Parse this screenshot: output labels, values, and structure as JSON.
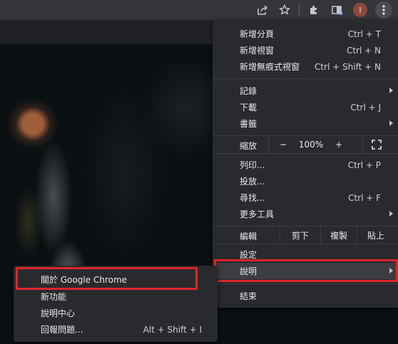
{
  "toolbar": {
    "icons": [
      "share-icon",
      "bookmark-star-icon",
      "extensions-icon",
      "reading-list-icon"
    ],
    "avatar_initial": "I",
    "menu_icon": "more-vertical-icon"
  },
  "main_menu": {
    "group1": [
      {
        "label": "新增分頁",
        "shortcut": "Ctrl + T"
      },
      {
        "label": "新增視窗",
        "shortcut": "Ctrl + N"
      },
      {
        "label": "新增無痕式視窗",
        "shortcut": "Ctrl + Shift + N"
      }
    ],
    "group2": [
      {
        "label": "記錄",
        "shortcut": ""
      },
      {
        "label": "下載",
        "shortcut": "Ctrl + J"
      },
      {
        "label": "書籤",
        "shortcut": ""
      }
    ],
    "zoom": {
      "label": "縮放",
      "minus": "−",
      "value": "100%",
      "plus": "+",
      "fullscreen_icon": "fullscreen-icon"
    },
    "group3": [
      {
        "label": "列印...",
        "shortcut": "Ctrl + P"
      },
      {
        "label": "投放...",
        "shortcut": ""
      },
      {
        "label": "尋找...",
        "shortcut": "Ctrl + F"
      },
      {
        "label": "更多工具",
        "shortcut": ""
      }
    ],
    "edit": {
      "label": "編輯",
      "cut": "剪下",
      "copy": "複製",
      "paste": "貼上"
    },
    "group4": [
      {
        "label": "設定"
      },
      {
        "label": "說明"
      }
    ],
    "exit": {
      "label": "結束"
    }
  },
  "help_submenu": {
    "items": [
      {
        "label": "關於 Google Chrome",
        "shortcut": ""
      },
      {
        "label": "新功能",
        "shortcut": ""
      },
      {
        "label": "說明中心",
        "shortcut": ""
      },
      {
        "label": "回報問題...",
        "shortcut": "Alt + Shift + I"
      }
    ]
  },
  "colors": {
    "menu_bg": "#292a2d",
    "highlight_box": "#e0242b",
    "hover_bg": "#3c3d40",
    "avatar_bg": "#8d4a3c"
  }
}
